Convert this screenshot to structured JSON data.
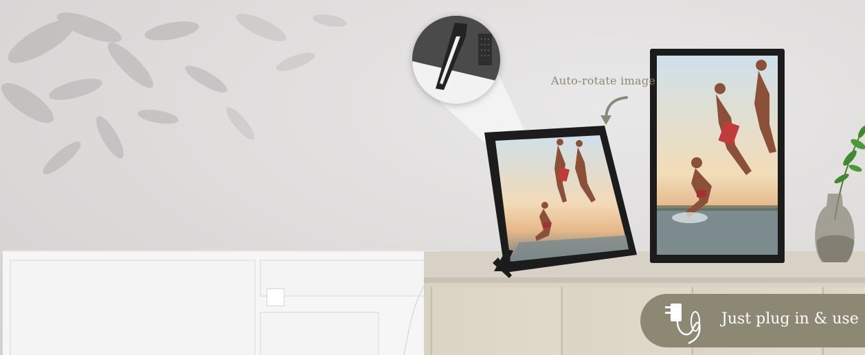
{
  "annotations": {
    "auto_rotate_label": "Auto-rotate image",
    "plug_badge_label": "Just plug in & use"
  },
  "icons": {
    "rotate_arrow": "curved-arrow-icon",
    "plug": "power-adapter-icon"
  },
  "colors": {
    "badge_background": "#8c8873",
    "caption_text": "#8c8776",
    "frame_bezel": "#1c1c1c"
  }
}
